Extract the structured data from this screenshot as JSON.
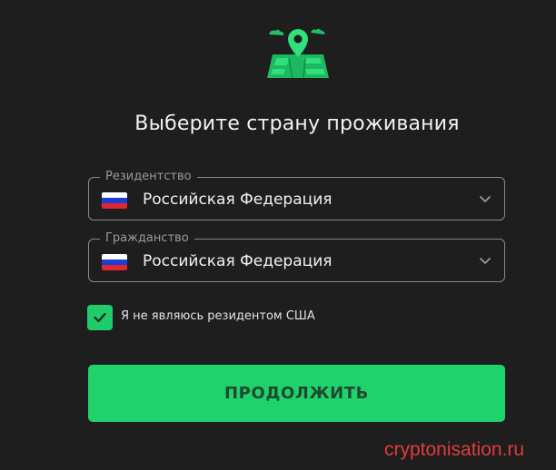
{
  "header": {
    "icon": "map-pin-icon",
    "title": "Выберите страну проживания"
  },
  "residency": {
    "label": "Резидентство",
    "value": "Российская Федерация",
    "flag": "russia-flag-icon"
  },
  "citizenship": {
    "label": "Гражданство",
    "value": "Российская Федерация",
    "flag": "russia-flag-icon"
  },
  "us_resident_checkbox": {
    "checked": true,
    "label": "Я не являюсь резидентом США"
  },
  "continue_button": {
    "label": "ПРОДОЛЖИТЬ"
  },
  "watermark": "cryptonisation.ru",
  "colors": {
    "accent": "#1fd26b",
    "background": "#1e1e1f",
    "border": "#8a8a8a",
    "watermark": "#e23b3b"
  }
}
